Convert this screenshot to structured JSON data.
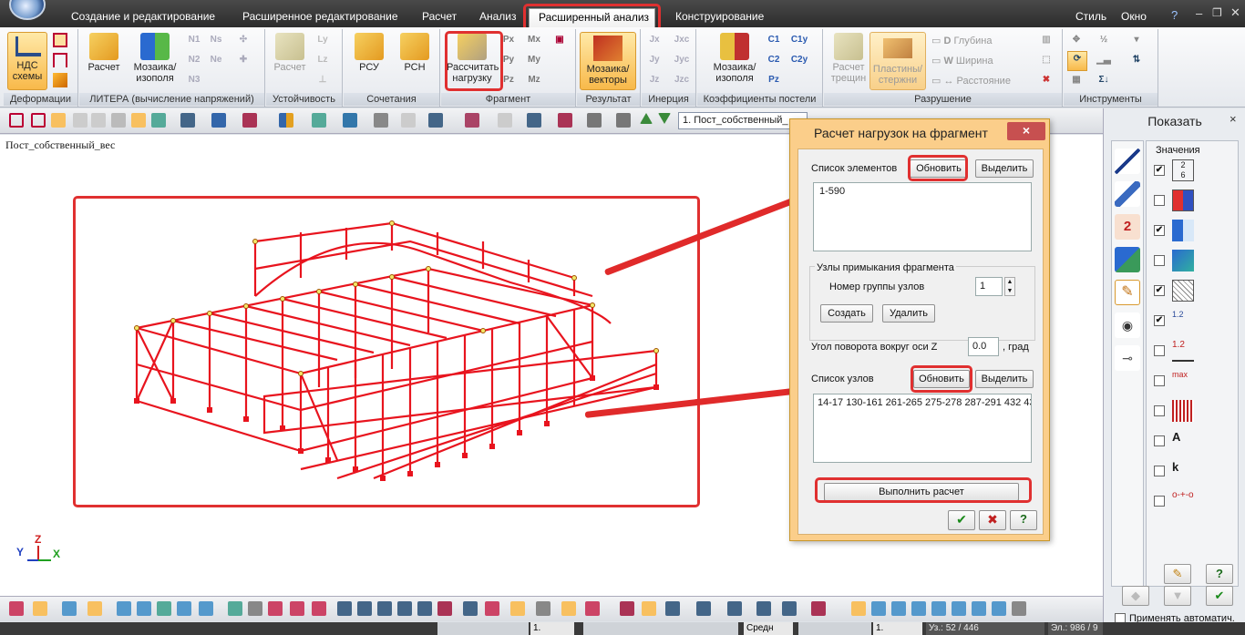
{
  "ribbon_tabs": [
    "Создание и редактирование",
    "Расширенное редактирование",
    "Расчет",
    "Анализ",
    "Расширенный анализ",
    "Конструирование"
  ],
  "ribbon_right": {
    "style": "Стиль",
    "window": "Окно"
  },
  "ribbon_groups": {
    "deform": {
      "label": "Деформации",
      "ndc": "НДС схемы"
    },
    "litera": {
      "label": "ЛИТЕРА (вычисление напряжений)",
      "calc": "Расчет",
      "mosaic": "Мозаика/ изополя",
      "n1": "N1",
      "n2": "N2",
      "n3": "N3",
      "ns": "Ns",
      "ne": "Ne"
    },
    "stab": {
      "label": "Устойчивость",
      "calc": "Расчет",
      "ly": "Ly",
      "lz": "Lz"
    },
    "comb": {
      "label": "Сочетания",
      "rsu": "РСУ",
      "rsn": "РСН"
    },
    "frag": {
      "label": "Фрагмент",
      "calc_loads": "Рассчитать нагрузку",
      "px": "Px",
      "py": "Py",
      "pz": "Pz",
      "mx": "Mx",
      "my": "My",
      "mz": "Mz"
    },
    "result": {
      "label": "Результат",
      "mosaic": "Мозаика/ векторы"
    },
    "inertia": {
      "label": "Инерция",
      "jx": "Jx",
      "jy": "Jy",
      "jz": "Jz",
      "jxc": "Jxc",
      "jyc": "Jyc",
      "jzc": "Jzc"
    },
    "bed": {
      "label": "Коэффициенты постели",
      "mosaic": "Мозаика/ изополя",
      "c1": "C1",
      "c2": "C2",
      "c1y": "C1y",
      "c2y": "C2y",
      "pz": "Pz"
    },
    "fract": {
      "label": "Разрушение",
      "calc_cracks": "Расчет трещин",
      "plates": "Пластины/ стержни",
      "depth": "Глубина",
      "width": "Ширина",
      "dist": "Расстояние"
    },
    "tools": {
      "label": "Инструменты"
    }
  },
  "toolbar": {
    "load_case_select": "1. Пост_собственный_"
  },
  "canvas": {
    "title": "Пост_собственный_вес",
    "axis_x": "X",
    "axis_y": "Y",
    "axis_z": "Z"
  },
  "dialog": {
    "title": "Расчет нагрузок на фрагмент",
    "close": "×",
    "elements_label": "Список элементов",
    "elements_update": "Обновить",
    "elements_select": "Выделить",
    "elements_value": "1-590",
    "nodes_group_title": "Узлы примыкания фрагмента",
    "group_num_label": "Номер группы узлов",
    "group_num_value": "1",
    "create": "Создать",
    "delete": "Удалить",
    "angle_label": "Угол поворота вокруг оси Z",
    "angle_value": "0.0",
    "angle_unit": ", град",
    "nodes_label": "Список узлов",
    "nodes_update": "Обновить",
    "nodes_select": "Выделить",
    "nodes_value": "14-17 130-161 261-265 275-278 287-291 432 43",
    "run": "Выполнить расчет",
    "ok": "✔",
    "cancel": "✖",
    "help": "?"
  },
  "show_panel": {
    "title": "Показать",
    "close": "×",
    "values_label": "Значения",
    "auto_apply": "Применять автоматич."
  },
  "bottom_toolbar": {
    "combo1": "1.",
    "combo2": "Средн",
    "combo3": "1."
  },
  "status": {
    "nodes": "Уз.: 52 / 446",
    "elements": "Эл.: 986 / 9"
  },
  "colors": {
    "accent_red": "#e03030",
    "model_red": "#e8141e",
    "dialog_frame": "#fbce8a"
  }
}
